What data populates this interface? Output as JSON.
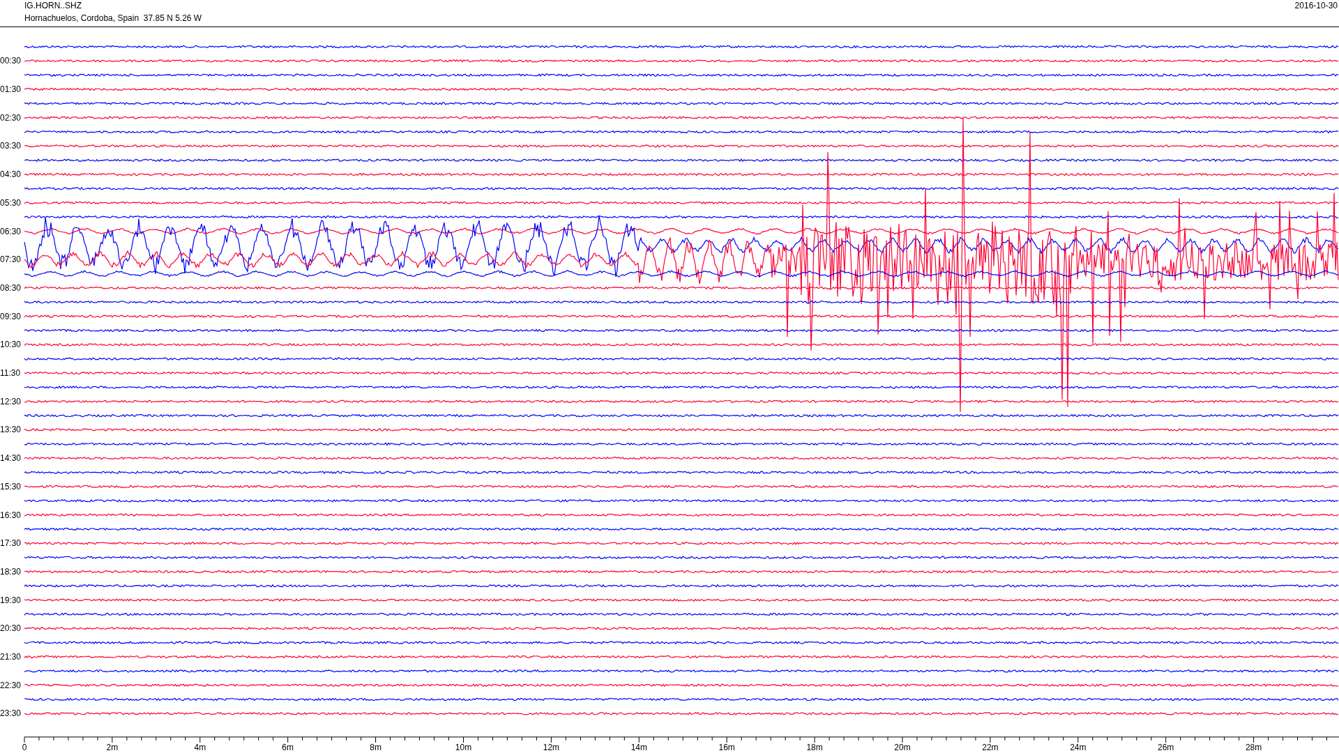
{
  "header": {
    "station": "IG.HORN..SHZ",
    "location": "Hornachuelos, Cordoba, Spain  37.85 N 5.26 W",
    "date": "2016-10-30"
  },
  "row_labels": [
    "00:30",
    "01:30",
    "02:30",
    "03:30",
    "04:30",
    "05:30",
    "06:30",
    "07:30",
    "08:30",
    "09:30",
    "10:30",
    "11:30",
    "12:30",
    "13:30",
    "14:30",
    "15:30",
    "16:30",
    "17:30",
    "18:30",
    "19:30",
    "20:30",
    "21:30",
    "22:30",
    "23:30"
  ],
  "x_axis": {
    "labels": [
      "0",
      "2m",
      "4m",
      "6m",
      "8m",
      "10m",
      "12m",
      "14m",
      "16m",
      "18m",
      "20m",
      "22m",
      "24m",
      "26m",
      "28m"
    ]
  }
}
